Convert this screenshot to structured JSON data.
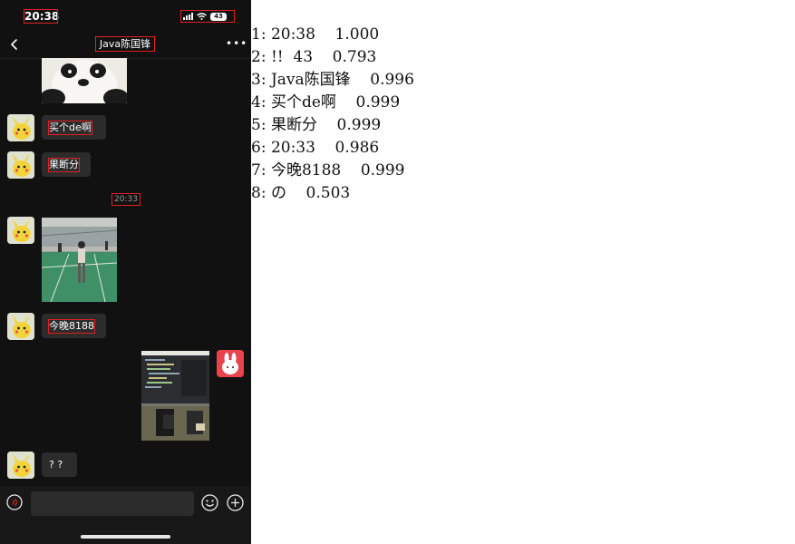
{
  "status_bar": {
    "time": "20:38",
    "battery": "43"
  },
  "header": {
    "title": "Java陈国锋"
  },
  "messages": [
    {
      "kind": "image",
      "side": "left",
      "content": "panda"
    },
    {
      "kind": "text",
      "side": "left",
      "text": "买个de啊"
    },
    {
      "kind": "text",
      "side": "left",
      "text": "果断分"
    },
    {
      "kind": "timestamp",
      "text": "20:33"
    },
    {
      "kind": "image",
      "side": "left",
      "content": "badminton court"
    },
    {
      "kind": "text",
      "side": "left",
      "text": "今晚8188"
    },
    {
      "kind": "image",
      "side": "right",
      "content": "code screen and device"
    },
    {
      "kind": "text",
      "side": "left",
      "text": "? ?"
    }
  ],
  "ocr_results": [
    "1: 20:38    1.000",
    "2: !!  43    0.793",
    "3: Java陈国锋    0.996",
    "4: 买个de啊    0.999",
    "5: 果断分    0.999",
    "6: 20:33    0.986",
    "7: 今晚8188    0.999",
    "8: の    0.503"
  ]
}
